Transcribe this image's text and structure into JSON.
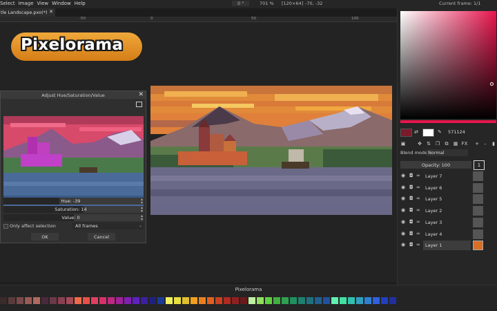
{
  "menu": [
    "Select",
    "Image",
    "View",
    "Window",
    "Help"
  ],
  "top_info": {
    "rotation": "0 °",
    "zoom": "701 %",
    "size": "[120×64]",
    "coords": "-70, -32",
    "current_frame": "Current frame: 1/1"
  },
  "tab": {
    "label": "tle Landscape.pxo(*)",
    "close": "✕"
  },
  "ruler": [
    "-50",
    "0",
    "50",
    "100"
  ],
  "logo_text": "Pixelorama",
  "dialog": {
    "title": "Adjust Hue/Saturation/Value",
    "close": "✕",
    "hue": "Hue: -39",
    "saturation": "Saturation: 14",
    "value": "Value: 0",
    "hue_level": 0.4,
    "saturation_level": 0.57,
    "value_level": 0.5,
    "only_affect_selection": "Only affect selection",
    "scope": "All frames",
    "ok": "OK",
    "cancel": "Cancel"
  },
  "bottom": {
    "title": "Pixelorama"
  },
  "palette": [
    "#3a2a2a",
    "#5a3b3b",
    "#7a4a4a",
    "#9a5a55",
    "#b06a60",
    "#4a2a3a",
    "#6b3a4a",
    "#8a4050",
    "#a54a5a",
    "#f06a4a",
    "#e8504a",
    "#e04060",
    "#d8306a",
    "#c02880",
    "#a0209a",
    "#8020b0",
    "#6020c0",
    "#3a20a0",
    "#202080",
    "#1a3a9a",
    "#f0f060",
    "#e8e040",
    "#e0c030",
    "#f0a020",
    "#e88020",
    "#e06020",
    "#c84020",
    "#b02a20",
    "#902020",
    "#6a1a1a",
    "#c0f0a0",
    "#90e060",
    "#60d040",
    "#40b040",
    "#30a050",
    "#209060",
    "#208070",
    "#207080",
    "#206090",
    "#2050a0",
    "#60f0b0",
    "#40e0a0",
    "#30c0b0",
    "#30a0c0",
    "#3080d0",
    "#3060e0",
    "#2040c0",
    "#2030a0"
  ],
  "right": {
    "primary_color": "#7a1a2a",
    "secondary_color": "#ffffff",
    "hex": "571124",
    "blend_label": "Blend mode:",
    "blend_value": "Normal",
    "opacity": "Opacity: 100",
    "frame": "1",
    "layers": [
      "Layer 7",
      "Layer 6",
      "Layer 5",
      "Layer 2",
      "Layer 3",
      "Layer 4",
      "Layer 1"
    ]
  }
}
